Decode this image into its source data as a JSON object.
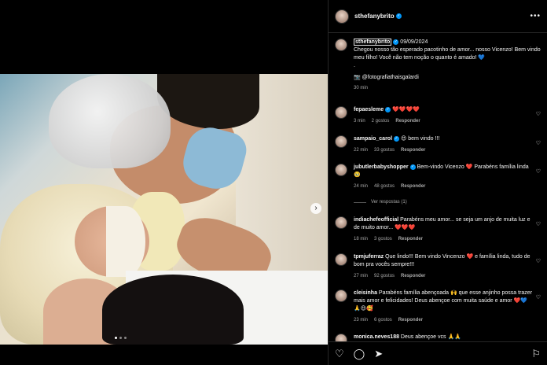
{
  "post": {
    "username": "sthefanybrito",
    "caption_author": "sthefanybrito",
    "date": "09/09/2024",
    "caption_text": "Chegou nosso tão esperado pacotinho de amor... nosso Vicenzo! Bem vindo meu filho! Você não tem noção o quanto é amado! 💙",
    "caption_dot": ".",
    "credit": "📷 @fotografiathaisgalardi",
    "time_ago": "30 min",
    "more_label": "•••",
    "carousel_next": "›"
  },
  "comments": [
    {
      "user": "fepaesleme",
      "text": " ❤️❤️❤️❤️",
      "age": "3 min",
      "likes": "2 gostos",
      "reply": "Responder"
    },
    {
      "user": "sampaio_carol",
      "text": " 😍 bem vindo !!!",
      "age": "22 min",
      "likes": "33 gostos",
      "reply": "Responder"
    },
    {
      "user": "jubutlerbabyshopper",
      "text": " Bem-vindo Vicenzo ❤️ Parabéns família linda 🥹",
      "age": "24 min",
      "likes": "48 gostos",
      "reply": "Responder"
    },
    {
      "user": "indiachefeofficial",
      "text": " Parabéns meu amor... se seja um anjo de muita luz e de muito amor... ❤️❤️❤️",
      "age": "18 min",
      "likes": "3 gostos",
      "reply": "Responder"
    },
    {
      "user": "tpmjuferraz",
      "text": " Que lindo!!! Bem vindo Vincenzo ❤️ e família linda, tudo de bom pra vocês sempre!!!",
      "age": "27 min",
      "likes": "92 gostos",
      "reply": "Responder"
    },
    {
      "user": "cleisinha",
      "text": " Parabéns família abençoada 🙌 que esse anjinho possa trazer mais amor e felicidades! Deus abençoe com muita saúde e amor ❤️💙🙏😍🥰",
      "age": "23 min",
      "likes": "6 gostos",
      "reply": "Responder"
    },
    {
      "user": "monica.neves188",
      "text": " Deus abençoe vcs 🙏🙏",
      "age": "",
      "likes": "",
      "reply": ""
    }
  ],
  "view_replies": "Ver respostas (1)",
  "actions": {
    "like": "♡",
    "comment": "◯",
    "share": "➤",
    "save": "⚐"
  },
  "colors": {
    "background": "#000000",
    "text": "#f5f5f5",
    "muted": "#a8a8a8",
    "verified": "#0095f6",
    "heart_red": "#ed4956"
  }
}
